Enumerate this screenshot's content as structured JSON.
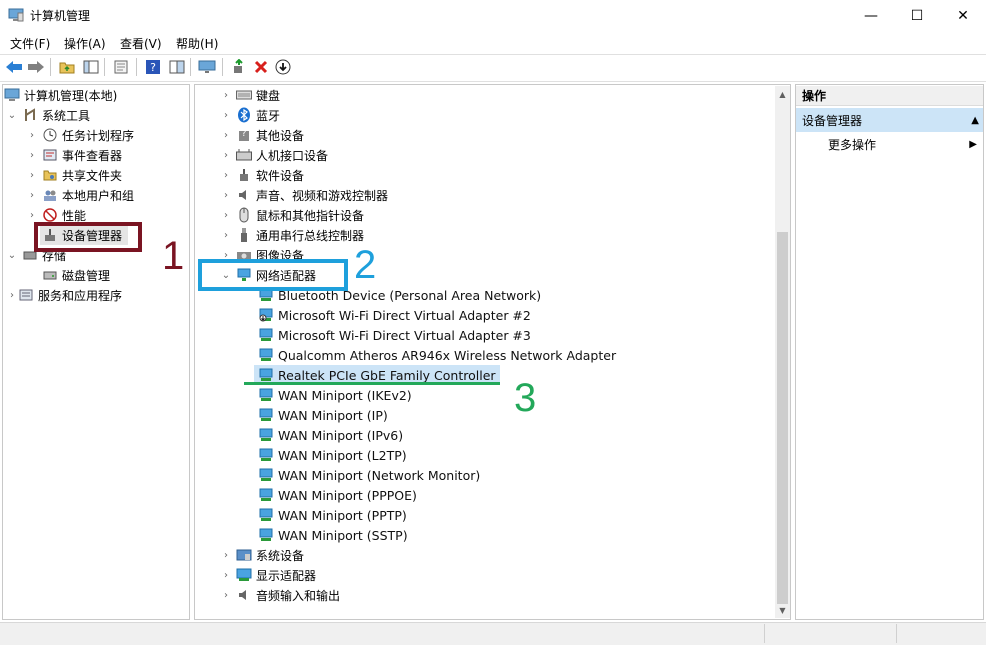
{
  "window": {
    "title": "计算机管理",
    "controls": {
      "minimize": "—",
      "maximize": "☐",
      "close": "✕"
    }
  },
  "menu": [
    "文件(F)",
    "操作(A)",
    "查看(V)",
    "帮助(H)"
  ],
  "left_tree": [
    {
      "label": "计算机管理(本地)",
      "icon": "computer-icon",
      "expanded": true
    },
    {
      "label": "系统工具",
      "icon": "tools-icon",
      "expanded": true
    },
    {
      "label": "任务计划程序",
      "icon": "clock-icon",
      "expanded": false
    },
    {
      "label": "事件查看器",
      "icon": "event-viewer-icon",
      "expanded": false
    },
    {
      "label": "共享文件夹",
      "icon": "shared-folder-icon",
      "expanded": false
    },
    {
      "label": "本地用户和组",
      "icon": "users-icon",
      "expanded": false
    },
    {
      "label": "性能",
      "icon": "performance-icon",
      "expanded": false
    },
    {
      "label": "设备管理器",
      "icon": "device-manager-icon",
      "selected": true
    },
    {
      "label": "存储",
      "icon": "storage-icon",
      "expanded": true
    },
    {
      "label": "磁盘管理",
      "icon": "disk-icon"
    },
    {
      "label": "服务和应用程序",
      "icon": "services-icon",
      "expanded": false
    }
  ],
  "device_tree": [
    {
      "label": "键盘",
      "icon": "keyboard-icon",
      "expanded": false
    },
    {
      "label": "蓝牙",
      "icon": "bluetooth-icon",
      "expanded": false
    },
    {
      "label": "其他设备",
      "icon": "other-device-icon",
      "expanded": false
    },
    {
      "label": "人机接口设备",
      "icon": "hid-icon",
      "expanded": false
    },
    {
      "label": "软件设备",
      "icon": "software-device-icon",
      "expanded": false
    },
    {
      "label": "声音、视频和游戏控制器",
      "icon": "speaker-icon",
      "expanded": false
    },
    {
      "label": "鼠标和其他指针设备",
      "icon": "mouse-icon",
      "expanded": false
    },
    {
      "label": "通用串行总线控制器",
      "icon": "usb-icon",
      "expanded": false
    },
    {
      "label": "图像设备",
      "icon": "camera-icon",
      "expanded": false
    },
    {
      "label": "网络适配器",
      "icon": "network-adapter-icon",
      "expanded": true
    }
  ],
  "network_adapters": [
    "Bluetooth Device (Personal Area Network)",
    "Microsoft Wi-Fi Direct Virtual Adapter #2",
    "Microsoft Wi-Fi Direct Virtual Adapter #3",
    "Qualcomm Atheros AR946x Wireless Network Adapter",
    "Realtek PCIe GbE Family Controller",
    "WAN Miniport (IKEv2)",
    "WAN Miniport (IP)",
    "WAN Miniport (IPv6)",
    "WAN Miniport (L2TP)",
    "WAN Miniport (Network Monitor)",
    "WAN Miniport (PPPOE)",
    "WAN Miniport (PPTP)",
    "WAN Miniport (SSTP)"
  ],
  "device_tree_after": [
    {
      "label": "系统设备",
      "icon": "system-device-icon",
      "expanded": false
    },
    {
      "label": "显示适配器",
      "icon": "display-adapter-icon",
      "expanded": false
    },
    {
      "label": "音频输入和输出",
      "icon": "audio-io-icon",
      "expanded": false
    }
  ],
  "actions": {
    "header": "操作",
    "section": "设备管理器",
    "more": "更多操作"
  },
  "annotations": {
    "one": "1",
    "two": "2",
    "three": "3"
  },
  "colors": {
    "annotation1": "#7a1422",
    "annotation2": "#1ea0dc",
    "annotation3": "#23a85a",
    "selected_bg": "#cce4f7"
  }
}
